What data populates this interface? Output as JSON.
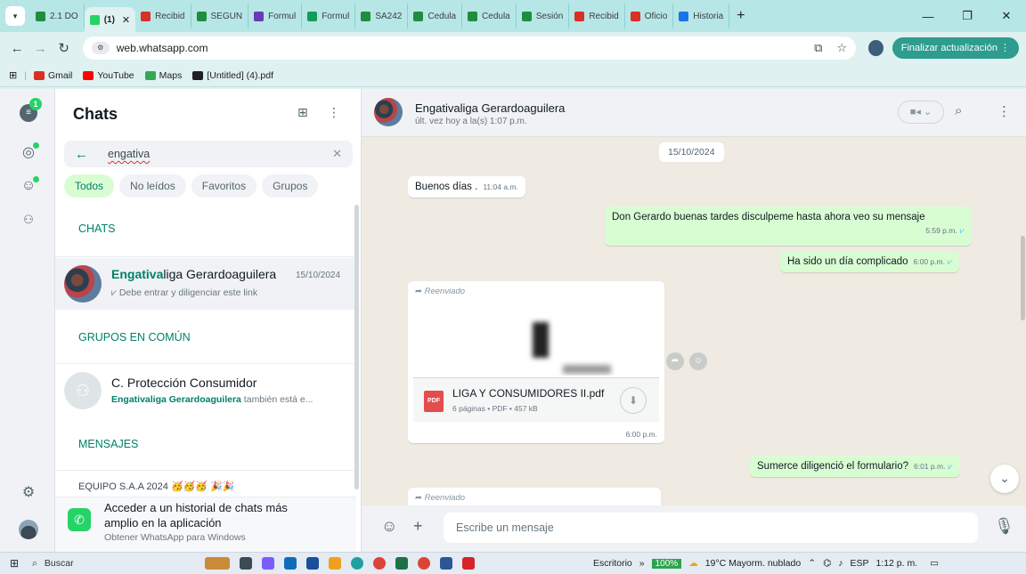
{
  "browser": {
    "tabs": [
      {
        "label": "2.1 DO",
        "color": "#1e8e3e"
      },
      {
        "label": "(1)",
        "color": "#25d366",
        "active": true
      },
      {
        "label": "Recibid",
        "color": "#d93025"
      },
      {
        "label": "SEGUN",
        "color": "#1e8e3e"
      },
      {
        "label": "Formul",
        "color": "#673ab7"
      },
      {
        "label": "Formul",
        "color": "#0f9d58"
      },
      {
        "label": "SA242",
        "color": "#1e8e3e"
      },
      {
        "label": "Cedula",
        "color": "#1e8e3e"
      },
      {
        "label": "Cedula",
        "color": "#1e8e3e"
      },
      {
        "label": "Sesión",
        "color": "#1e8e3e"
      },
      {
        "label": "Recibid",
        "color": "#d93025"
      },
      {
        "label": "Oficio",
        "color": "#d93025"
      },
      {
        "label": "Historia",
        "color": "#1a73e8"
      }
    ],
    "tab_close": "✕",
    "new_tab": "+",
    "url": "web.whatsapp.com",
    "update_label": "Finalizar actualización",
    "bookmarks": [
      {
        "label": "Gmail",
        "color": "#d93025"
      },
      {
        "label": "YouTube",
        "color": "#ff0000"
      },
      {
        "label": "Maps",
        "color": "#34a853"
      },
      {
        "label": "[Untitled] (4).pdf",
        "color": "#202124"
      }
    ]
  },
  "rail": {
    "badge": "1"
  },
  "list": {
    "title": "Chats",
    "search_value": "engativa",
    "filters": [
      "Todos",
      "No leídos",
      "Favoritos",
      "Grupos"
    ],
    "sections": {
      "chats": "CHATS",
      "groups": "GRUPOS EN COMÚN",
      "messages": "MENSAJES"
    },
    "chat_result": {
      "name_highlight": "Engativa",
      "name_rest": "liga Gerardoaguilera",
      "date": "15/10/2024",
      "preview": "⩗ Debe entrar y diligenciar este link"
    },
    "group_result": {
      "name": "C. Protección Consumidor",
      "member_highlight": "Engativaliga Gerardoaguilera",
      "member_rest": " también está e..."
    },
    "message_result_partial": "EQUIPO S.A.A 2024 🥳🥳🥳 🎉🎉",
    "promo": {
      "line1": "Acceder a un historial de chats más",
      "line2": "amplio en la aplicación",
      "sub": "Obtener WhatsApp para Windows"
    }
  },
  "chat": {
    "contact": "Engativaliga Gerardoaguilera",
    "last_seen": "últ. vez hoy a la(s) 1:07 p.m.",
    "date_chip": "15/10/2024",
    "messages": [
      {
        "dir": "in",
        "text": "Buenos días .",
        "time": "11:04 a.m."
      },
      {
        "dir": "out",
        "text": "Don Gerardo buenas tardes disculpeme hasta ahora veo su mensaje",
        "time": "5:59 p.m."
      },
      {
        "dir": "out",
        "text": "Ha sido un día complicado",
        "time": "6:00 p.m."
      },
      {
        "dir": "in",
        "forwarded": "Reenviado",
        "doc_name": "LIGA Y CONSUMIDORES II.pdf",
        "doc_meta": "6 páginas • PDF • 457 kB",
        "time": "6:00 p.m."
      },
      {
        "dir": "out",
        "text": "Sumerce diligenció el formulario?",
        "time": "6:01 p.m."
      },
      {
        "dir": "in",
        "forwarded": "Reenviado"
      }
    ],
    "ticks": "⩗",
    "pdf_label": "PDF",
    "composer_placeholder": "Escribe un mensaje"
  },
  "taskbar": {
    "search": "Buscar",
    "desktop": "Escritorio",
    "overflow": "»",
    "zoom": "100%",
    "weather": "19°C  Mayorm. nublado",
    "lang": "ESP",
    "time": "1:12 p. m."
  }
}
